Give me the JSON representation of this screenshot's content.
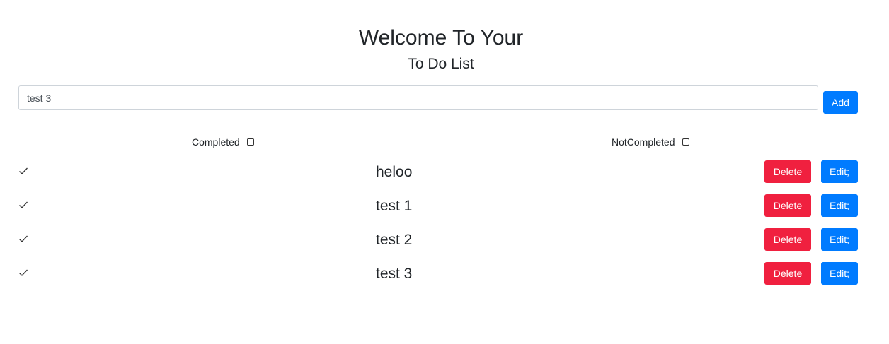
{
  "header": {
    "title": "Welcome To Your",
    "subtitle": "To Do List"
  },
  "input": {
    "value": "test 3",
    "add_label": "Add"
  },
  "filters": {
    "completed_label": "Completed",
    "completed_checked": false,
    "not_completed_label": "NotCompleted",
    "not_completed_checked": false
  },
  "todos": [
    {
      "text": "heloo",
      "completed": true,
      "delete_label": "Delete",
      "edit_label": "Edit;"
    },
    {
      "text": "test 1",
      "completed": true,
      "delete_label": "Delete",
      "edit_label": "Edit;"
    },
    {
      "text": "test 2",
      "completed": true,
      "delete_label": "Delete",
      "edit_label": "Edit;"
    },
    {
      "text": "test 3",
      "completed": true,
      "delete_label": "Delete",
      "edit_label": "Edit;"
    }
  ],
  "colors": {
    "primary": "#007bff",
    "danger": "#f0203f",
    "text": "#212529"
  },
  "icons": {
    "completed": "check-icon"
  }
}
